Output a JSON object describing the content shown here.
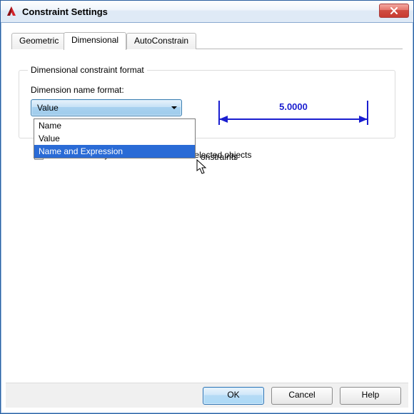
{
  "window": {
    "title": "Constraint Settings"
  },
  "tabs": {
    "geometric": "Geometric",
    "dimensional": "Dimensional",
    "autoconstrain": "AutoConstrain",
    "active": "Dimensional"
  },
  "group": {
    "legend": "Dimensional constraint format",
    "name_format_label": "Dimension name format:"
  },
  "combo": {
    "selected": "Value",
    "options": [
      "Name",
      "Value",
      "Name and Expression"
    ],
    "highlighted_index": 2
  },
  "preview": {
    "value_text": "5.0000"
  },
  "partial_visible_text": "onstraints",
  "checkbox_show_hidden": {
    "checked": true,
    "label": "Show hidden dynamic constraints for selected objects"
  },
  "buttons": {
    "ok": "OK",
    "cancel": "Cancel",
    "help": "Help"
  },
  "colors": {
    "dim_blue": "#1a1ed0"
  }
}
